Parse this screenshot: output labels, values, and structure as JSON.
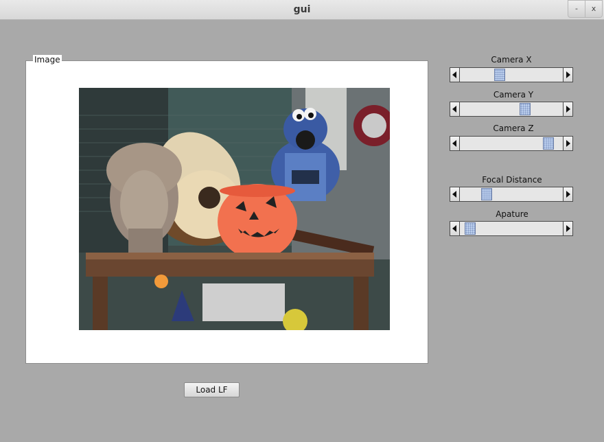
{
  "window": {
    "title": "gui",
    "minimize_glyph": "-",
    "close_glyph": "x"
  },
  "image_panel": {
    "label": "Image"
  },
  "load_button": {
    "label": "Load LF"
  },
  "sliders": [
    {
      "label": "Camera X",
      "value": 0.37
    },
    {
      "label": "Camera Y",
      "value": 0.65
    },
    {
      "label": "Camera Z",
      "value": 0.9
    },
    {
      "label": "Focal Distance",
      "value": 0.23
    },
    {
      "label": "Apature",
      "value": 0.05
    }
  ],
  "colors": {
    "background": "#a9a9a9",
    "panel": "#ffffff",
    "thumb": "#bcd0ee"
  },
  "icons": {
    "scroll_left": "triangle-left-icon",
    "scroll_right": "triangle-right-icon"
  }
}
